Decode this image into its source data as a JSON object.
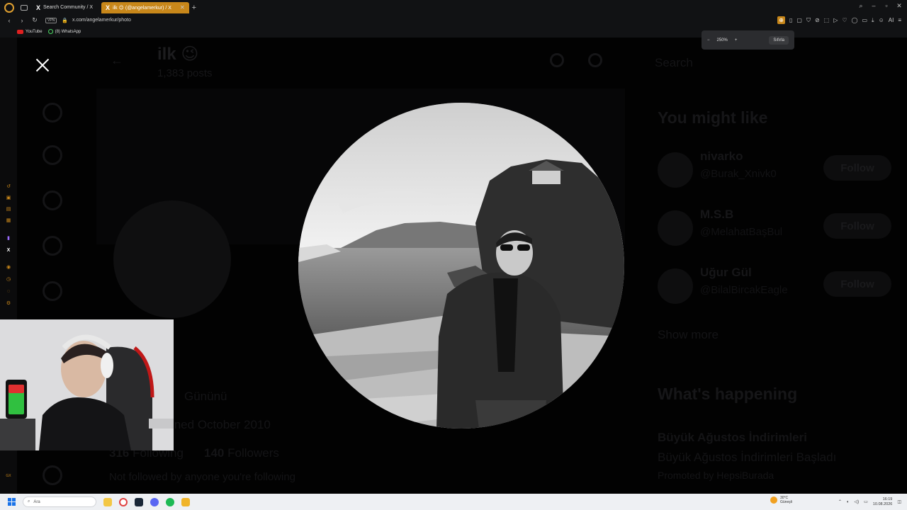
{
  "browser": {
    "tabs": [
      {
        "label": "Search Community / X"
      },
      {
        "label": "ilk 😉 (@angelamerkur) / X"
      }
    ],
    "url": "x.com/angelamerkur/photo",
    "vpn": "VPN",
    "bookmarks": [
      {
        "label": "YouTube"
      },
      {
        "label": "(8) WhatsApp"
      }
    ],
    "zoom": {
      "level": "250%",
      "minus": "−",
      "plus": "+",
      "reset": "Sıfırla"
    },
    "accent": "#c8871a"
  },
  "page": {
    "profile_name": "ilk 😉",
    "posts": "1,383 posts",
    "joined": "Joined October 2010",
    "following_count": "316",
    "following_label": "Following",
    "followers_count": "140",
    "followers_label": "Followers",
    "bio_fragment": "Gününü",
    "not_followed": "Not followed by anyone you're following"
  },
  "right_col": {
    "search_placeholder": "Search",
    "might_like_title": "You might like",
    "suggestions": [
      {
        "name": "nivarko",
        "handle": "@Burak_Xnivk0",
        "follow": "Follow"
      },
      {
        "name": "M.S.B",
        "handle": "@MelahatBaşBul",
        "follow": "Follow"
      },
      {
        "name": "Uğur Gül",
        "handle": "@BilalBircakEagle",
        "follow": "Follow"
      }
    ],
    "show_more": "Show more",
    "happening_title": "What's happening",
    "trend_title": "Büyük Ağustos İndirimleri",
    "trend_sub": "Büyük Ağustos İndirimleri Başladı",
    "trend_promo": "Promoted by HepsiBurada"
  },
  "taskbar": {
    "search_placeholder": "Ara",
    "weather_temp": "30°C",
    "weather_desc": "Güneşli",
    "time": "16:19",
    "date": "10.08.2026"
  }
}
